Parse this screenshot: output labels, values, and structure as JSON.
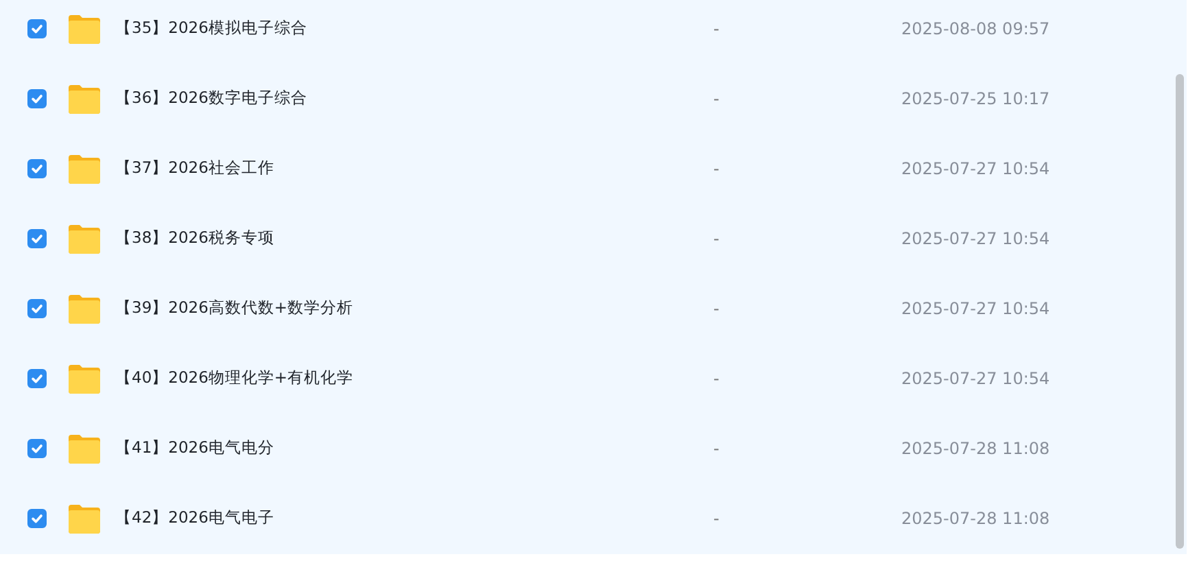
{
  "files": [
    {
      "name": "【35】2026模拟电子综合",
      "size": "-",
      "modified": "2025-08-08 09:57",
      "checked": true
    },
    {
      "name": "【36】2026数字电子综合",
      "size": "-",
      "modified": "2025-07-25 10:17",
      "checked": true
    },
    {
      "name": "【37】2026社会工作",
      "size": "-",
      "modified": "2025-07-27 10:54",
      "checked": true
    },
    {
      "name": "【38】2026税务专项",
      "size": "-",
      "modified": "2025-07-27 10:54",
      "checked": true
    },
    {
      "name": "【39】2026高数代数+数学分析",
      "size": "-",
      "modified": "2025-07-27 10:54",
      "checked": true
    },
    {
      "name": "【40】2026物理化学+有机化学",
      "size": "-",
      "modified": "2025-07-27 10:54",
      "checked": true
    },
    {
      "name": "【41】2026电气电分",
      "size": "-",
      "modified": "2025-07-28 11:08",
      "checked": true
    },
    {
      "name": "【42】2026电气电子",
      "size": "-",
      "modified": "2025-07-28 11:08",
      "checked": true
    }
  ]
}
